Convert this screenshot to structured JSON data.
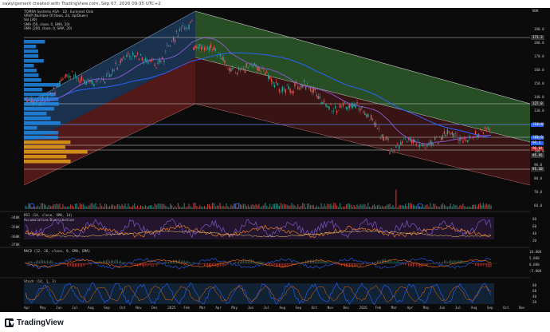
{
  "header": {
    "caption": "sawyigsment created with TradingView.com, Sep 07, 2026 09:35 UTC+2"
  },
  "legend": {
    "line1": "TOMRA Systems ASA · 1D · Euronext Oslo",
    "line2": "VRVP (Number Of Rows, 24, Up/Down)",
    "line3": "Vol (30)",
    "line4": "SMA (50, close, 0, SMA, 20)",
    "line5": "SMA (200, close, 0, SMA, 20)"
  },
  "price_axis": {
    "labels": [
      "190.0",
      "180.0",
      "170.0",
      "160.0",
      "150.0",
      "140.0",
      "130.0",
      "120.0",
      "110.0",
      "100.0",
      "90.0",
      "80.0",
      "70.0",
      "60.0"
    ],
    "top_tag": "NOK",
    "tags": [
      "171.3",
      "127.0",
      "113.8",
      "103.6",
      "99.4",
      "95.95",
      "91.10"
    ],
    "last_price": "96.04"
  },
  "panes": {
    "rsi_title": "RSI (14, close, SMA, 14)",
    "rsi_labels": [
      "80",
      "60",
      "40",
      "20"
    ],
    "adl_title": "Accumulation/Distribution",
    "macd_title": "MACD (12, 26, close, 9, EMA, EMA)",
    "macd_labels": [
      "10.000",
      "5.000",
      "0.000",
      "-5.000"
    ],
    "stoch_title": "Stoch (14, 1, 3)",
    "stoch_labels": [
      "80",
      "60",
      "40",
      "20"
    ],
    "adl_labels": [
      "-340K",
      "-350K",
      "-360K",
      "-370K"
    ]
  },
  "time_axis": [
    "Apr",
    "May",
    "Jun",
    "Jul",
    "Aug",
    "Sep",
    "Oct",
    "Nov",
    "Dec",
    "2025",
    "Feb",
    "Mar",
    "Apr",
    "May",
    "Jun",
    "Jul",
    "Aug",
    "Sep",
    "Oct",
    "Nov",
    "Dec",
    "2026",
    "Feb",
    "Mar",
    "Apr",
    "May",
    "Jun",
    "Jul",
    "Aug",
    "Sep",
    "Oct",
    "Nov"
  ],
  "footer": {
    "brand": "TradingView"
  },
  "colors": {
    "bg": "#0b0b0b",
    "up": "#26a69a",
    "down": "#ef5350",
    "sma50": "#7e57c2",
    "sma200": "#2962ff",
    "channel_green": "#4caf50",
    "channel_red": "#c62828",
    "channel_blue": "#1e88e5"
  }
}
